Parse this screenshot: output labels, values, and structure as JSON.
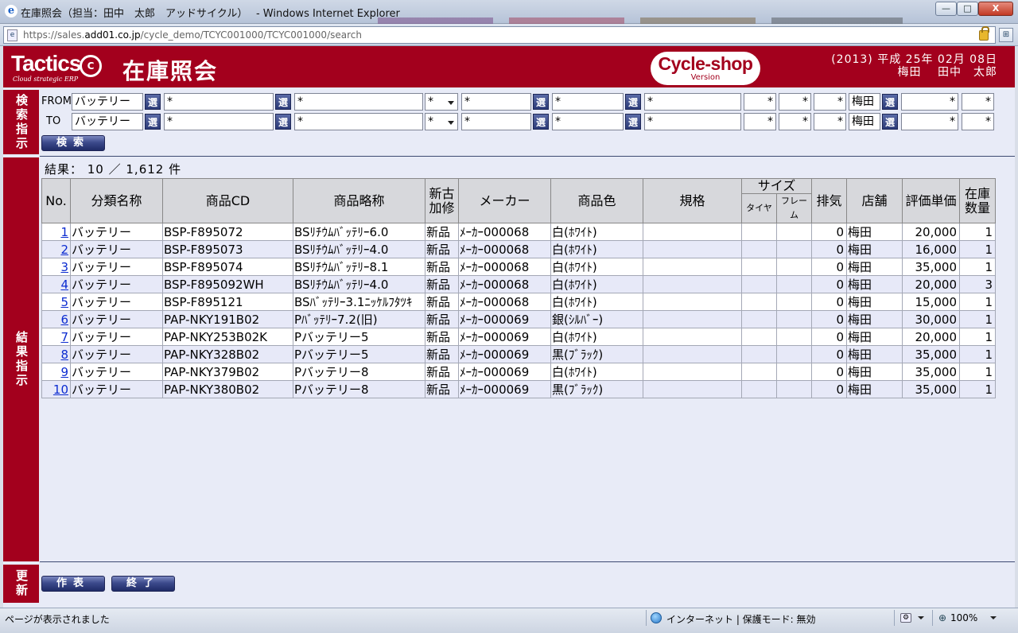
{
  "window": {
    "title": "在庫照会（担当：田中　太郎　アッドサイクル）　 - Windows Internet Explorer",
    "url_prefix": "https://sales.",
    "url_domain": "add01.co.jp",
    "url_path": "/cycle_demo/TCYC001000/TCYC001000/search",
    "minimize": "—",
    "maximize": "□",
    "close": "X"
  },
  "header": {
    "logo_text": "Tactics",
    "logo_mark": "C",
    "logo_tagline": "Cloud strategic ERP",
    "screen_title": "在庫照会",
    "badge_name": "Cycle-shop",
    "badge_sub": "Version",
    "date_line": "(2013) 平成 25年 02月 08日",
    "user_line": "梅田　 田中　太郎"
  },
  "side_labels": {
    "search": "検索指示",
    "result": "結果指示",
    "update": "更新"
  },
  "search": {
    "from_label": "FROM",
    "to_label": "TO",
    "select_label": "選",
    "from": {
      "category": "バッテリー",
      "code": "*",
      "name": "*",
      "newold": "*",
      "maker": "*",
      "color": "*",
      "spec": "*",
      "tire": "*",
      "frame": "*",
      "exhaust": "*",
      "store": "梅田",
      "price": "*",
      "qty": "*"
    },
    "to": {
      "category": "バッテリー",
      "code": "*",
      "name": "*",
      "newold": "*",
      "maker": "*",
      "color": "*",
      "spec": "*",
      "tire": "*",
      "frame": "*",
      "exhaust": "*",
      "store": "梅田",
      "price": "*",
      "qty": "*"
    },
    "search_button": "検索"
  },
  "result": {
    "count_text": "結果： 10 ／ 1,612 件",
    "headers": {
      "no": "No.",
      "category": "分類名称",
      "code": "商品CD",
      "name": "商品略称",
      "newold": "新古加修",
      "maker": "メーカー",
      "color": "商品色",
      "spec": "規格",
      "size": "サイズ",
      "tire": "タイヤ",
      "frame": "フレーム",
      "exhaust": "排気",
      "store": "店舗",
      "price": "評価単価",
      "qty": "在庫数量"
    },
    "rows": [
      {
        "no": "1",
        "category": "バッテリー",
        "code": "BSP-F895072",
        "name": "BSﾘﾁｳﾑﾊﾞｯﾃﾘｰ6.0",
        "newold": "新品",
        "maker": "ﾒｰｶｰ000068",
        "color": "白(ﾎﾜｲﾄ)",
        "spec": "",
        "tire": "",
        "frame": "",
        "exhaust": "0",
        "store": "梅田",
        "price": "20,000",
        "qty": "1"
      },
      {
        "no": "2",
        "category": "バッテリー",
        "code": "BSP-F895073",
        "name": "BSﾘﾁｳﾑﾊﾞｯﾃﾘｰ4.0",
        "newold": "新品",
        "maker": "ﾒｰｶｰ000068",
        "color": "白(ﾎﾜｲﾄ)",
        "spec": "",
        "tire": "",
        "frame": "",
        "exhaust": "0",
        "store": "梅田",
        "price": "16,000",
        "qty": "1"
      },
      {
        "no": "3",
        "category": "バッテリー",
        "code": "BSP-F895074",
        "name": "BSﾘﾁｳﾑﾊﾞｯﾃﾘｰ8.1",
        "newold": "新品",
        "maker": "ﾒｰｶｰ000068",
        "color": "白(ﾎﾜｲﾄ)",
        "spec": "",
        "tire": "",
        "frame": "",
        "exhaust": "0",
        "store": "梅田",
        "price": "35,000",
        "qty": "1"
      },
      {
        "no": "4",
        "category": "バッテリー",
        "code": "BSP-F895092WH",
        "name": "BSﾘﾁｳﾑﾊﾞｯﾃﾘｰ4.0",
        "newold": "新品",
        "maker": "ﾒｰｶｰ000068",
        "color": "白(ﾎﾜｲﾄ)",
        "spec": "",
        "tire": "",
        "frame": "",
        "exhaust": "0",
        "store": "梅田",
        "price": "20,000",
        "qty": "3"
      },
      {
        "no": "5",
        "category": "バッテリー",
        "code": "BSP-F895121",
        "name": "BSﾊﾞｯﾃﾘｰ3.1ﾆｯｹﾙﾌﾀﾂｷ",
        "newold": "新品",
        "maker": "ﾒｰｶｰ000068",
        "color": "白(ﾎﾜｲﾄ)",
        "spec": "",
        "tire": "",
        "frame": "",
        "exhaust": "0",
        "store": "梅田",
        "price": "15,000",
        "qty": "1"
      },
      {
        "no": "6",
        "category": "バッテリー",
        "code": "PAP-NKY191B02",
        "name": "Pﾊﾞｯﾃﾘｰ7.2(旧)",
        "newold": "新品",
        "maker": "ﾒｰｶｰ000069",
        "color": "銀(ｼﾙﾊﾞｰ)",
        "spec": "",
        "tire": "",
        "frame": "",
        "exhaust": "0",
        "store": "梅田",
        "price": "30,000",
        "qty": "1"
      },
      {
        "no": "7",
        "category": "バッテリー",
        "code": "PAP-NKY253B02K",
        "name": "Pバッテリー5",
        "newold": "新品",
        "maker": "ﾒｰｶｰ000069",
        "color": "白(ﾎﾜｲﾄ)",
        "spec": "",
        "tire": "",
        "frame": "",
        "exhaust": "0",
        "store": "梅田",
        "price": "20,000",
        "qty": "1"
      },
      {
        "no": "8",
        "category": "バッテリー",
        "code": "PAP-NKY328B02",
        "name": "Pバッテリー5",
        "newold": "新品",
        "maker": "ﾒｰｶｰ000069",
        "color": "黒(ﾌﾞﾗｯｸ)",
        "spec": "",
        "tire": "",
        "frame": "",
        "exhaust": "0",
        "store": "梅田",
        "price": "35,000",
        "qty": "1"
      },
      {
        "no": "9",
        "category": "バッテリー",
        "code": "PAP-NKY379B02",
        "name": "Pバッテリー8",
        "newold": "新品",
        "maker": "ﾒｰｶｰ000069",
        "color": "白(ﾎﾜｲﾄ)",
        "spec": "",
        "tire": "",
        "frame": "",
        "exhaust": "0",
        "store": "梅田",
        "price": "35,000",
        "qty": "1"
      },
      {
        "no": "10",
        "category": "バッテリー",
        "code": "PAP-NKY380B02",
        "name": "Pバッテリー8",
        "newold": "新品",
        "maker": "ﾒｰｶｰ000069",
        "color": "黒(ﾌﾞﾗｯｸ)",
        "spec": "",
        "tire": "",
        "frame": "",
        "exhaust": "0",
        "store": "梅田",
        "price": "35,000",
        "qty": "1"
      }
    ]
  },
  "footer": {
    "make_button": "作表",
    "end_button": "終了"
  },
  "status": {
    "message": "ページが表示されました",
    "zone": "インターネット | 保護モード: 無効",
    "zoom": "100%"
  },
  "colors": {
    "brand": "#a3001d",
    "button": "#2b3a78",
    "content_bg": "#e8ebf7",
    "row_alt": "#e7e9f8"
  }
}
